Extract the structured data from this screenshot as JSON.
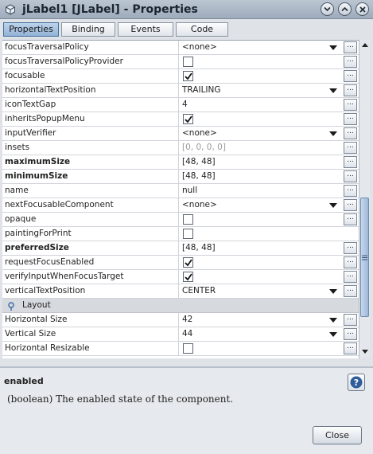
{
  "window": {
    "title": "jLabel1 [JLabel] - Properties"
  },
  "tabs": [
    {
      "label": "Properties",
      "active": true
    },
    {
      "label": "Binding",
      "active": false
    },
    {
      "label": "Events",
      "active": false
    },
    {
      "label": "Code",
      "active": false
    }
  ],
  "properties": [
    {
      "name": "focusTraversalPolicy",
      "value": "<none>",
      "kind": "combo"
    },
    {
      "name": "focusTraversalPolicyProvider",
      "value": false,
      "kind": "check"
    },
    {
      "name": "focusable",
      "value": true,
      "kind": "check"
    },
    {
      "name": "horizontalTextPosition",
      "value": "TRAILING",
      "kind": "combo"
    },
    {
      "name": "iconTextGap",
      "value": "4",
      "kind": "text"
    },
    {
      "name": "inheritsPopupMenu",
      "value": true,
      "kind": "check"
    },
    {
      "name": "inputVerifier",
      "value": "<none>",
      "kind": "combo"
    },
    {
      "name": "insets",
      "value": "[0, 0, 0, 0]",
      "kind": "text",
      "disabled": true
    },
    {
      "name": "maximumSize",
      "value": "[48, 48]",
      "kind": "text",
      "bold": true
    },
    {
      "name": "minimumSize",
      "value": "[48, 48]",
      "kind": "text",
      "bold": true
    },
    {
      "name": "name",
      "value": "null",
      "kind": "text"
    },
    {
      "name": "nextFocusableComponent",
      "value": "<none>",
      "kind": "combo"
    },
    {
      "name": "opaque",
      "value": false,
      "kind": "check"
    },
    {
      "name": "paintingForPrint",
      "value": false,
      "kind": "check",
      "no_ellipsis": true
    },
    {
      "name": "preferredSize",
      "value": "[48, 48]",
      "kind": "text",
      "bold": true
    },
    {
      "name": "requestFocusEnabled",
      "value": true,
      "kind": "check"
    },
    {
      "name": "verifyInputWhenFocusTarget",
      "value": true,
      "kind": "check"
    },
    {
      "name": "verticalTextPosition",
      "value": "CENTER",
      "kind": "combo"
    }
  ],
  "category": {
    "label": "Layout"
  },
  "layout_properties": [
    {
      "name": "Horizontal Size",
      "value": "42",
      "kind": "combo"
    },
    {
      "name": "Vertical Size",
      "value": "44",
      "kind": "combo"
    },
    {
      "name": "Horizontal Resizable",
      "value": false,
      "kind": "check"
    }
  ],
  "description": {
    "title": "enabled",
    "text": "(boolean) The enabled state of the component."
  },
  "buttons": {
    "close": "Close",
    "ellipsis": "..."
  },
  "colors": {
    "accent": "#3f6e9f",
    "titlebar": "#aeb9c7",
    "category_bg": "#d6d9dd"
  },
  "icons": {
    "window": "netbeans-cube-icon",
    "minimize": "chevron-down-icon",
    "maximize": "chevron-up-icon",
    "category": "pin-icon",
    "help": "help-icon"
  }
}
